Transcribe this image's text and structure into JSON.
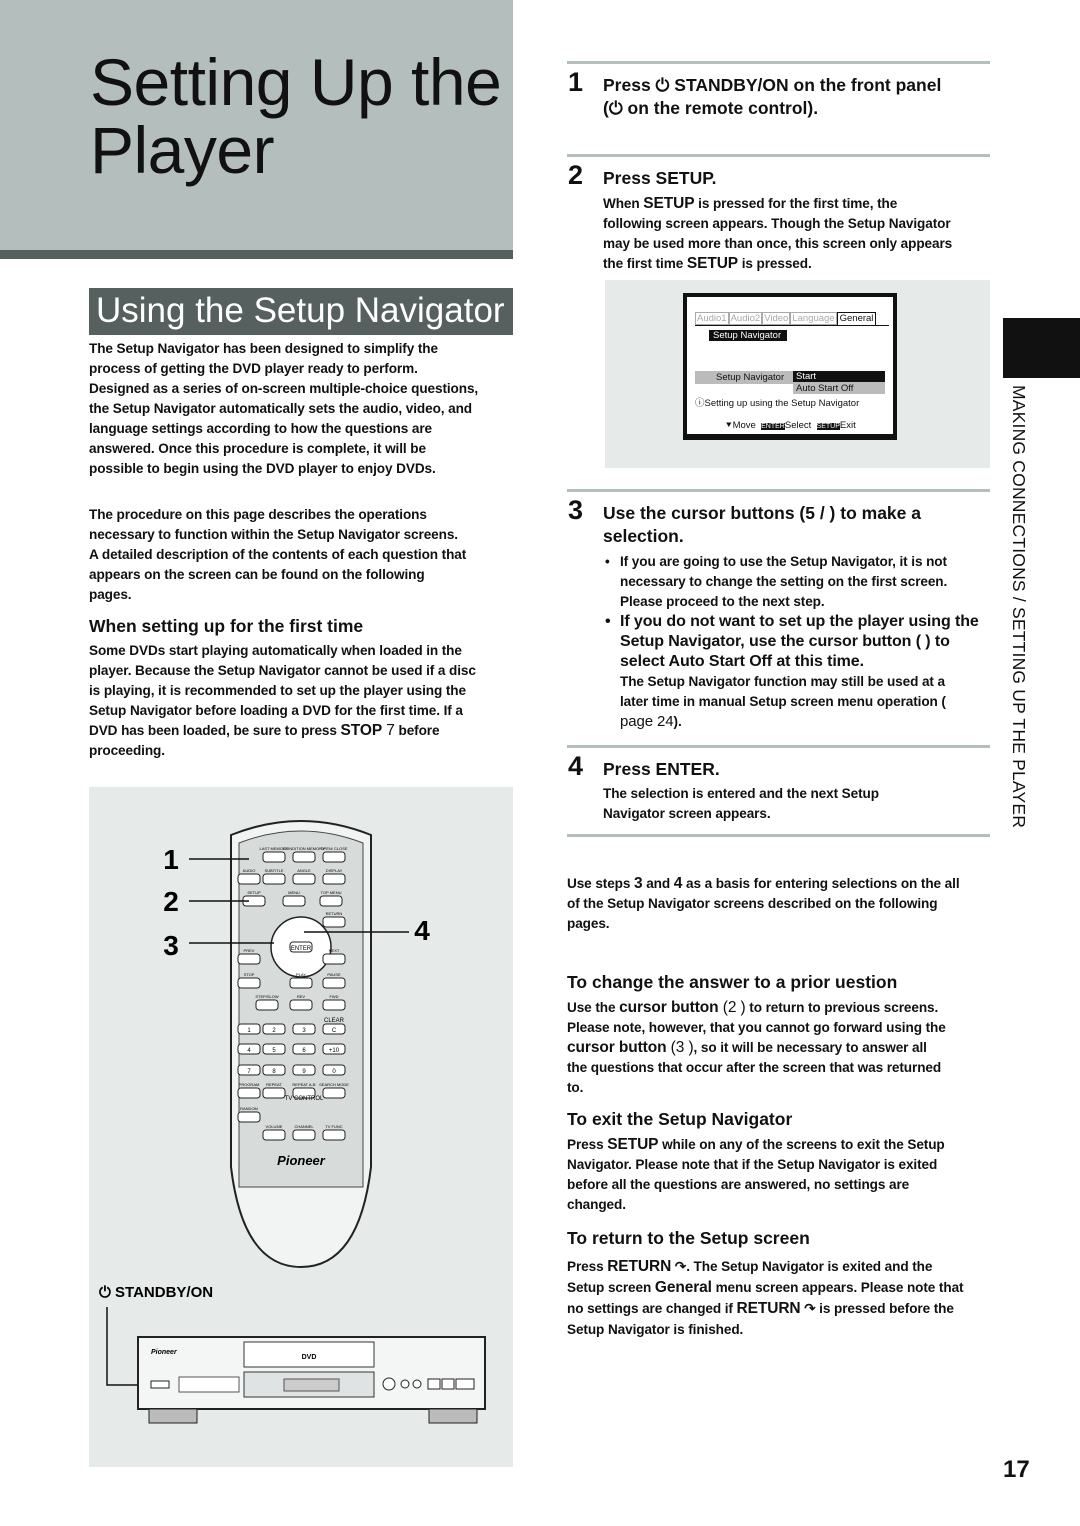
{
  "title": "Setting Up the Player",
  "section_title": "Using the Setup Navigator",
  "intro": [
    "The Setup Navigator has been designed to simplify the process of getting the DVD player ready to perform. Designed as a series of on-screen multiple-choice questions, the Setup Navigator automatically sets the audio, video, and language settings according to how the questions are answered. Once this procedure is complete, it will be possible to begin using the DVD player to enjoy DVDs.",
    "The procedure on this page describes the operations necessary to function within the Setup Navigator screens. A detailed description of the contents of each question that appears on the screen can be found on the following pages."
  ],
  "first_time": {
    "heading": "When setting up for the first time",
    "text": "Some DVDs start playing automatically when loaded in the player. Because the Setup Navigator cannot be used if a disc is playing, it is recommended to set up the player using the Setup Navigator before loading a DVD for the first time. If a DVD has been loaded, be sure to press ",
    "key": "STOP",
    "sym": " 7",
    "end": " before proceeding."
  },
  "illustration": {
    "callouts": [
      "1",
      "2",
      "3",
      "4"
    ],
    "standby_label": "STANDBY/ON",
    "brand": "Pioneer",
    "dvd_logo": "DVD",
    "remote_buttons": [
      "LAST MEMORY",
      "CONDITION MEMORY",
      "OPEN/ CLOSE",
      "AUDIO",
      "SUBTITLE",
      "ANGLE",
      "DISPLAY",
      "SETUP",
      "MENU",
      "TOP MENU",
      "RETURN",
      "ENTER",
      "PREV",
      "NEXT",
      "STOP",
      "PLAY",
      "PAUSE",
      "STEP/SLOW",
      "REV",
      "FWD",
      "CLEAR",
      "1",
      "2",
      "3",
      "C",
      "4",
      "5",
      "6",
      "+10",
      "7",
      "8",
      "9",
      "0",
      "PROGRAM",
      "REPEAT",
      "REPEAT A-B",
      "SEARCH MODE",
      "RANDOM",
      "TV CONTROL",
      "VOLUME",
      "CHANNEL",
      "TV FUNC"
    ]
  },
  "steps": [
    {
      "num": "1",
      "heading_a": "Press ",
      "key_a": "STANDBY/ON",
      "heading_b": " on the front panel",
      "heading_c": "on the remote control)."
    },
    {
      "num": "2",
      "heading": "Press SETUP.",
      "text_a": "When ",
      "key": "SETUP",
      "text_b": " is pressed for the first time, the following screen appears. Though the Setup Navigator may be used more than once, this screen only appears the first time ",
      "text_c": " is pressed."
    },
    {
      "num": "3",
      "heading": "Use the cursor buttons (5 /    ) to make a selection.",
      "bullet1": "If you are going to use the Setup Navigator, it is not necessary to change the setting on the first screen. Please proceed to the next step.",
      "bullet2": "If you do not want to set up the player using the Setup Navigator, use the cursor button (   ) to select   Auto Start Off   at this time.",
      "bullet2_note": "The Setup Navigator function may still be used at a later time in manual Setup screen menu operation ( ",
      "page_ref": "page 24",
      "note_end": ")."
    },
    {
      "num": "4",
      "heading": "Press ENTER.",
      "text": "The selection is entered and the next Setup Navigator screen appears."
    }
  ],
  "screen": {
    "tabs": [
      "Audio1",
      "Audio2",
      "Video",
      "Language",
      "General"
    ],
    "active_tab": "General",
    "title": "Setup Navigator",
    "row_label": "Setup Navigator",
    "options": [
      "Start",
      "Auto Start Off"
    ],
    "info": "Setting up using the Setup Navigator",
    "footer": {
      "move": "Move",
      "enter_key": "ENTER",
      "select": "Select",
      "setup_key": "SETUP",
      "exit": "Exit"
    }
  },
  "use_steps": {
    "a": "Use steps  ",
    "n3": "3",
    "b": " and  ",
    "n4": "4",
    "c": " as a basis for entering selections on the all of the Setup Navigator screens described on the following pages."
  },
  "change": {
    "heading": "To change the answer to a prior   uestion",
    "a": "Use the  ",
    "k1": "cursor button",
    "s1": " (2 )",
    "b": " to return to previous screens. Please note, however, that you cannot go forward using the  ",
    "k2": "cursor button",
    "s2": " (3 )",
    "c": ", so it will be necessary to answer all the questions that occur after the screen that was returned to."
  },
  "exit": {
    "heading": "To exit the Setup Navigator",
    "a": "Press  ",
    "key": "SETUP",
    "b": " while on any of the screens to exit the Setup Navigator. Please note that if the Setup Navigator is exited before all the questions are answered, no settings are changed."
  },
  "ret": {
    "heading": "To return to the Setup screen",
    "a": "Press  ",
    "key": "RETURN",
    "b": ". The Setup Navigator is exited and the Setup screen  ",
    "key2": "General",
    "c": " menu screen appears. Please note that no settings are changed if     ",
    "key3": "RETURN",
    "d": " is pressed before the Setup Navigator is finished."
  },
  "side_tab": "MAKING CONNECTIONS / SETTING UP THE PLAYER",
  "page_number": "17",
  "colors": {
    "title_box": "#b4bfbd",
    "header_bar": "#56605e",
    "panel": "#e6eae9"
  }
}
